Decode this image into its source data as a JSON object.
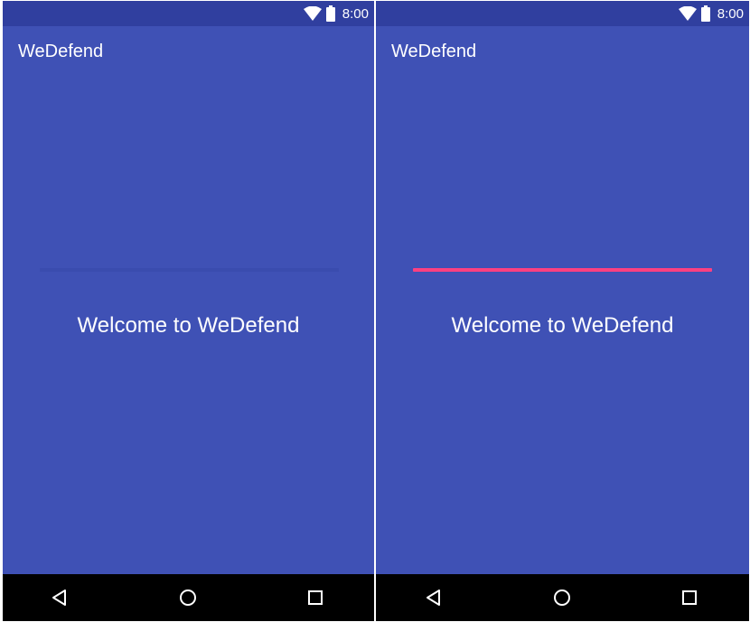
{
  "screens": [
    {
      "status_bar": {
        "time": "8:00",
        "icons": [
          "wifi-icon",
          "battery-icon"
        ]
      },
      "app_bar": {
        "title": "WeDefend"
      },
      "progress": {
        "value": 0,
        "track_color": "#3a4cae"
      },
      "welcome_text": "Welcome to WeDefend",
      "nav_bar": {
        "buttons": [
          "back-icon",
          "home-icon",
          "recents-icon"
        ]
      }
    },
    {
      "status_bar": {
        "time": "8:00",
        "icons": [
          "wifi-icon",
          "battery-icon"
        ]
      },
      "app_bar": {
        "title": "WeDefend"
      },
      "progress": {
        "value": 1,
        "fill_color": "#ff4081"
      },
      "welcome_text": "Welcome to WeDefend",
      "nav_bar": {
        "buttons": [
          "back-icon",
          "home-icon",
          "recents-icon"
        ]
      }
    }
  ],
  "colors": {
    "primary": "#3f51b5",
    "primary_dark": "#303f9f",
    "accent": "#ff4081",
    "nav_bar": "#000000",
    "text": "#ffffff"
  }
}
